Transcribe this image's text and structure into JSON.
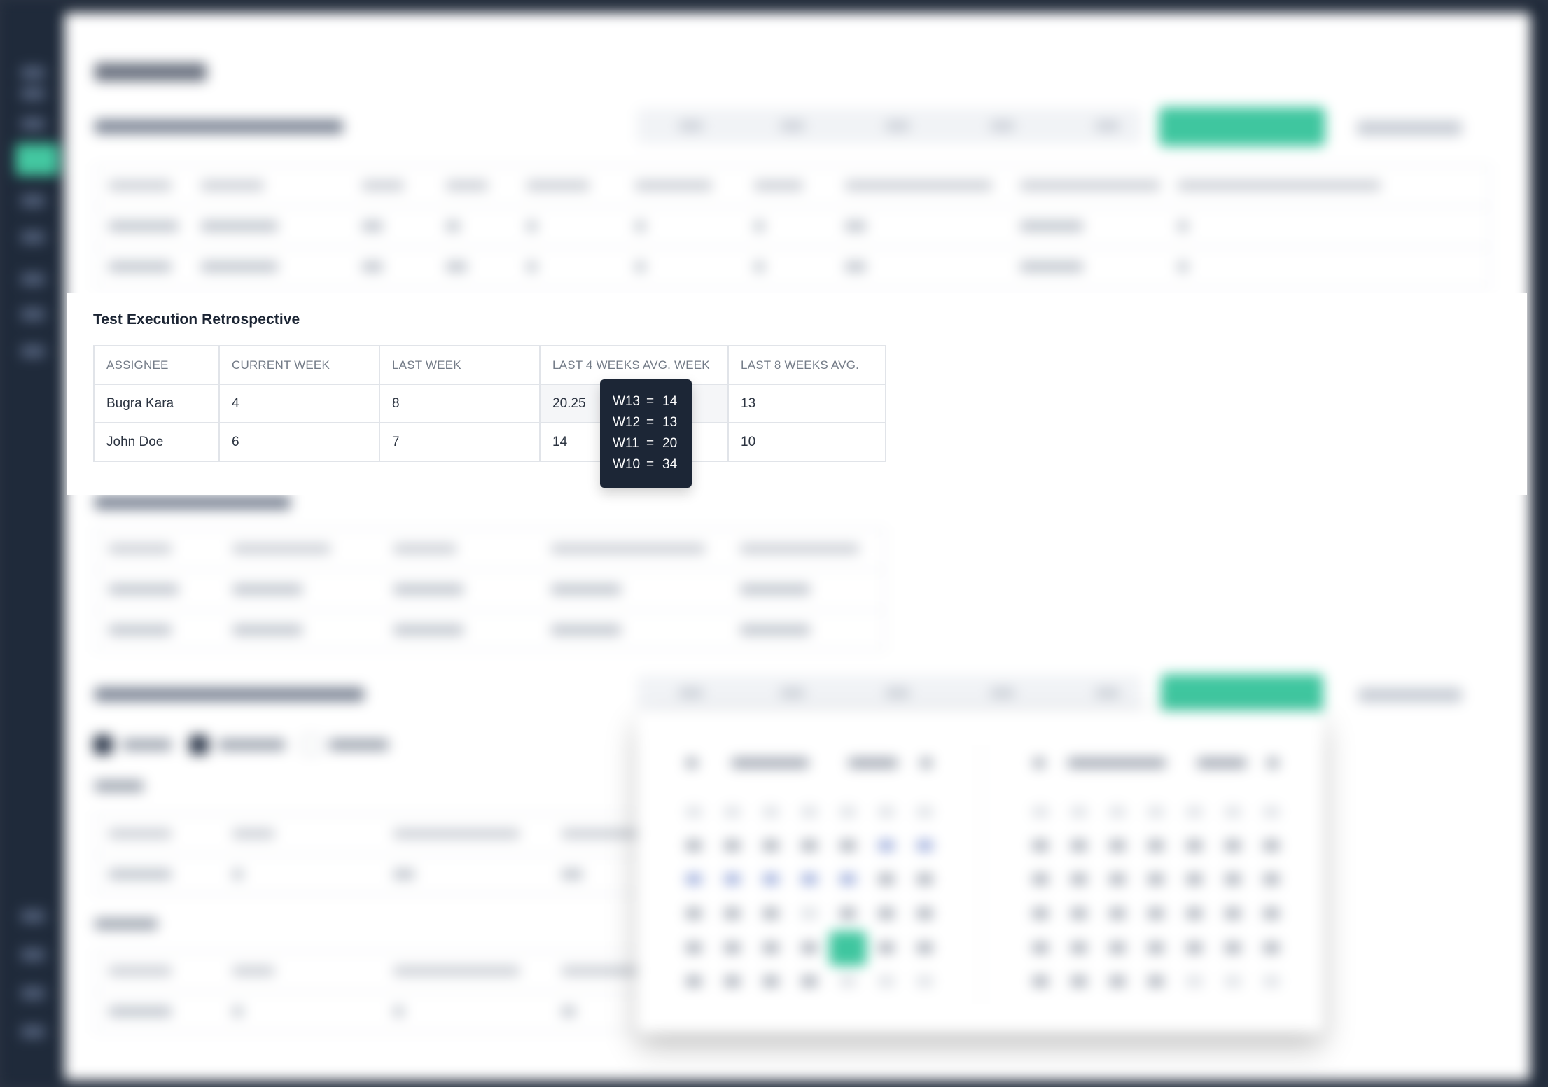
{
  "section": {
    "title": "Test Execution Retrospective",
    "columns": [
      "ASSIGNEE",
      "CURRENT WEEK",
      "LAST WEEK",
      "LAST 4 WEEKS AVG. WEEK",
      "LAST 8 WEEKS AVG."
    ],
    "rows": [
      {
        "assignee": "Bugra Kara",
        "current_week": "4",
        "last_week": "8",
        "last_4_weeks_avg": "20.25",
        "last_8_weeks_avg": "13"
      },
      {
        "assignee": "John Doe",
        "current_week": "6",
        "last_week": "7",
        "last_4_weeks_avg": "14",
        "last_8_weeks_avg": "10"
      }
    ]
  },
  "tooltip": {
    "rows": [
      {
        "week": "W13",
        "eq": "=",
        "value": "14"
      },
      {
        "week": "W12",
        "eq": "=",
        "value": "13"
      },
      {
        "week": "W11",
        "eq": "=",
        "value": "20"
      },
      {
        "week": "W10",
        "eq": "=",
        "value": "34"
      }
    ]
  },
  "colors": {
    "accent_green": "#3fc69f",
    "tooltip_bg": "#1c2636",
    "sidebar_bg": "#1f2a3a"
  }
}
